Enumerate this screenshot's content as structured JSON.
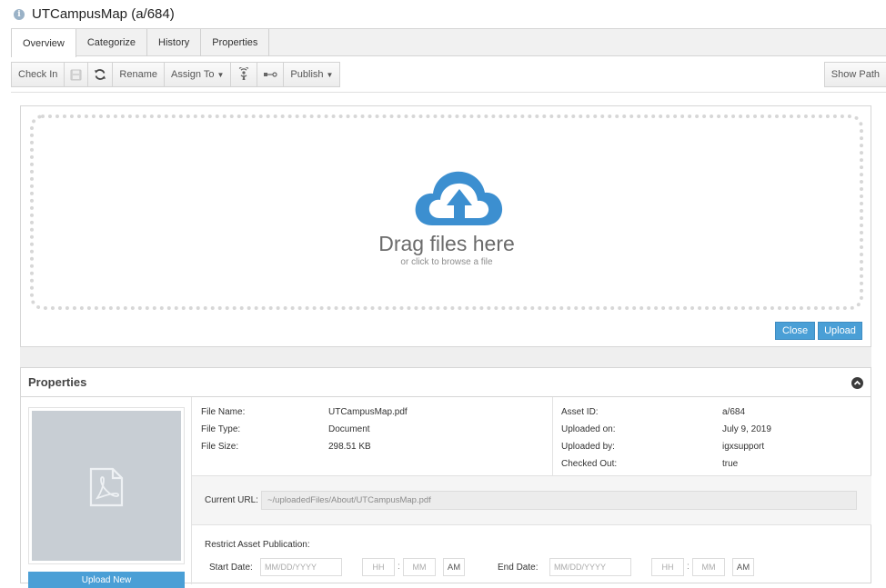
{
  "window": {
    "title": "UTCampusMap (a/684)"
  },
  "tabs": [
    {
      "label": "Overview"
    },
    {
      "label": "Categorize"
    },
    {
      "label": "History"
    },
    {
      "label": "Properties"
    }
  ],
  "toolbar": {
    "check_in": "Check In",
    "rename": "Rename",
    "assign_to": "Assign To",
    "publish": "Publish",
    "show_path": "Show Path"
  },
  "upload": {
    "title": "Drag files here",
    "subtitle": "or click to browse a file",
    "close": "Close",
    "upload": "Upload"
  },
  "properties": {
    "header": "Properties",
    "upload_new": "Upload New",
    "file_name_label": "File Name:",
    "file_name": "UTCampusMap.pdf",
    "file_type_label": "File Type:",
    "file_type": "Document",
    "file_size_label": "File Size:",
    "file_size": "298.51 KB",
    "asset_id_label": "Asset ID:",
    "asset_id": "a/684",
    "uploaded_on_label": "Uploaded on:",
    "uploaded_on": "July 9, 2019",
    "uploaded_by_label": "Uploaded by:",
    "uploaded_by": "igxsupport",
    "checked_out_label": "Checked Out:",
    "checked_out": "true",
    "current_url_label": "Current URL:",
    "current_url": "~/uploadedFiles/About/UTCampusMap.pdf",
    "restrict_label": "Restrict Asset Publication:",
    "start_date_label": "Start Date:",
    "end_date_label": "End Date:",
    "date_placeholder": "MM/DD/YYYY",
    "hour_placeholder": "HH",
    "minute_placeholder": "MM",
    "ampm": "AM"
  },
  "colors": {
    "accent": "#4a9fd6",
    "thumb_bg": "#c8ced4"
  }
}
